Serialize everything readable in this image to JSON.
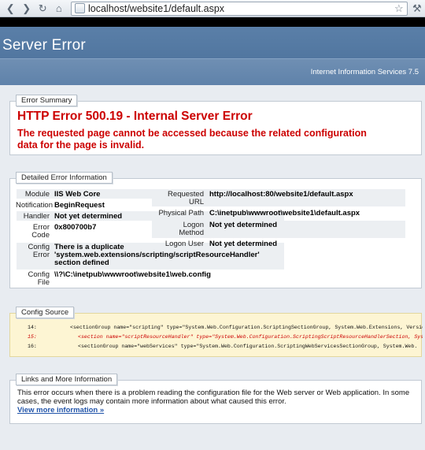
{
  "browser": {
    "url": "localhost/website1/default.aspx"
  },
  "header": {
    "title": "Server Error",
    "subtitle": "Internet Information Services 7.5"
  },
  "summary": {
    "legend": "Error Summary",
    "heading": "HTTP Error 500.19 - Internal Server Error",
    "message_line1": "The requested page cannot be accessed because the related configuration",
    "message_line2": "data for the page is invalid."
  },
  "detail": {
    "legend": "Detailed Error Information",
    "left": [
      {
        "label": "Module",
        "value": "IIS Web Core"
      },
      {
        "label": "Notification",
        "value": "BeginRequest"
      },
      {
        "label": "Handler",
        "value": "Not yet determined"
      },
      {
        "label1": "Error",
        "label2": "Code",
        "value": "0x800700b7"
      },
      {
        "label1": "Config",
        "label2": "Error",
        "value1": "There is a duplicate",
        "value2": "'system.web.extensions/scripting/scriptResourceHandler'",
        "value3": "section defined"
      },
      {
        "label1": "Config",
        "label2": "File",
        "value": "\\\\?\\C:\\inetpub\\wwwroot\\website1\\web.config"
      }
    ],
    "right": [
      {
        "label1": "Requested",
        "label2": "URL",
        "value": "http://localhost:80/website1/default.aspx"
      },
      {
        "label": "Physical Path",
        "value": "C:\\inetpub\\wwwroot\\website1\\default.aspx"
      },
      {
        "label1": "Logon",
        "label2": "Method",
        "value": "Not yet determined"
      },
      {
        "label": "Logon User",
        "value": "Not yet determined"
      }
    ]
  },
  "config": {
    "legend": "Config Source",
    "lines": [
      {
        "num": "14:",
        "text": "<sectionGroup name=\"scripting\" type=\"System.Web.Configuration.ScriptingSectionGroup, System.Web.Extensions, Version"
      },
      {
        "num": "15:",
        "text": "<section name=\"scriptResourceHandler\" type=\"System.Web.Configuration.ScriptingScriptResourceHandlerSection, Sys"
      },
      {
        "num": "16:",
        "text": "<sectionGroup name=\"webServices\" type=\"System.Web.Configuration.ScriptingWebServicesSectionGroup, System.Web."
      }
    ]
  },
  "links": {
    "legend": "Links and More Information",
    "paragraph": "This error occurs when there is a problem reading the configuration file for the Web server or Web application. In some cases, the event logs may contain more information about what caused this error.",
    "more_link": "View more information »"
  }
}
